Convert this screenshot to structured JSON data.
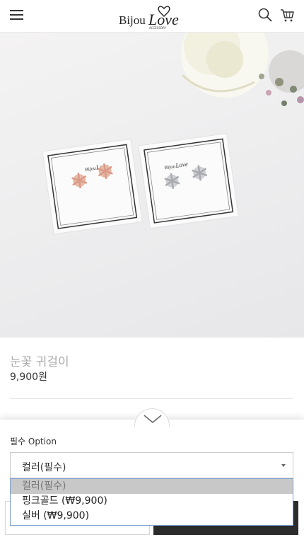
{
  "header": {
    "menu_icon": "hamburger-menu-icon",
    "logo_text_bijou": "Bijou",
    "logo_text_love": "Love",
    "logo_subtext": "ACCESSORY",
    "search_icon": "search-icon",
    "cart_icon": "cart-icon"
  },
  "product": {
    "title": "눈꽃 귀걸이",
    "price": "9,900원"
  },
  "options": {
    "label": "필수 Option",
    "selected_value": "컬러(필수)",
    "items": [
      {
        "label": "컬러(필수)"
      },
      {
        "label": "핑크골드 (₩9,900)"
      },
      {
        "label": "실버 (₩9,900)"
      }
    ]
  },
  "colors": {
    "accent_dark": "#2c2c2c",
    "dropdown_border": "#7fa0d0",
    "selected_bg": "#c8c8c8"
  }
}
